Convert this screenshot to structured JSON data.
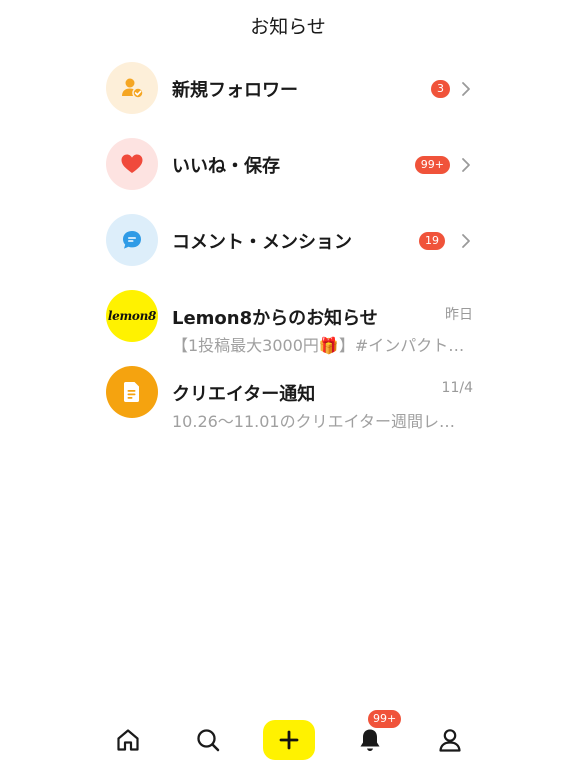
{
  "header": {
    "title": "お知らせ"
  },
  "notifications": [
    {
      "title": "新規フォロワー",
      "badge": "3",
      "icon": "user-follow-icon",
      "icon_bg": "#fdefd9",
      "icon_color": "#f5a623"
    },
    {
      "title": "いいね・保存",
      "badge": "99+",
      "icon": "heart-icon",
      "icon_bg": "#fde3e1",
      "icon_color": "#f04a3b"
    },
    {
      "title": "コメント・メンション",
      "badge": "19",
      "icon": "comment-icon",
      "icon_bg": "#ddeefa",
      "icon_color": "#2f9be6"
    },
    {
      "title": "Lemon8からのお知らせ",
      "time": "昨日",
      "subtitle": "【1投稿最大3000円🎁】#インパクト…",
      "icon": "lemon8-logo",
      "icon_bg": "#fff200",
      "logo_text": "lemon8"
    },
    {
      "title": "クリエイター通知",
      "time": "11/4",
      "subtitle": "10.26〜11.01のクリエイター週間レ…",
      "icon": "document-icon",
      "icon_bg": "#f5a30f"
    }
  ],
  "bottom_nav": {
    "items": [
      "home-icon",
      "search-icon",
      "plus-icon",
      "bell-icon",
      "profile-icon"
    ],
    "bell_badge": "99+",
    "plus_bg": "#fff200"
  },
  "colors": {
    "badge": "#f0533a",
    "secondary_text": "#9a9a9a"
  }
}
